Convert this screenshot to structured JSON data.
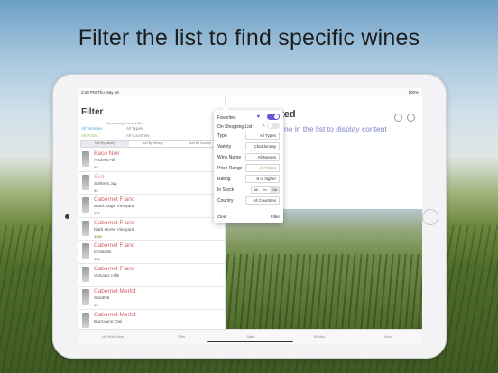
{
  "headline": "Filter the list to find specific wines",
  "status": {
    "time": "2:20 PM",
    "date": "Thu May 16",
    "battery": "100%"
  },
  "master": {
    "title": "Filter",
    "tap_hint": "Tap to change current filter",
    "summary": {
      "varieties": "All Varieties",
      "types": "All Types",
      "prices": "All Prices",
      "countries": "All Countries"
    },
    "sort_buttons": [
      "Sort By Variety",
      "Sort By Winery",
      "Sort By Country"
    ],
    "wines": [
      {
        "name": "Baco Noir",
        "maker": "Ancient Hill",
        "price": "$$"
      },
      {
        "name": "Bird",
        "maker": "Steller's Jay",
        "price": "$$"
      },
      {
        "name": "Cabernet Franc",
        "maker": "Black Sage Vineyard",
        "price": "$$$"
      },
      {
        "name": "Cabernet Franc",
        "maker": "Dark Horse Vineyard",
        "price": "$$$$"
      },
      {
        "name": "Cabernet Franc",
        "maker": "Inniskillin",
        "price": "$$$"
      },
      {
        "name": "Cabernet Franc",
        "maker": "Volcanic Hills",
        "price": ""
      },
      {
        "name": "Cabernet Merlot",
        "maker": "Sandhill",
        "price": "$$"
      },
      {
        "name": "Cabernet Merlot",
        "maker": "Burrowing Owl",
        "price": ""
      }
    ]
  },
  "detail": {
    "title": "cted",
    "hint": "ne in the list to display content"
  },
  "filter_popover": {
    "favorites_label": "Favorites",
    "shopping_label": "On Shopping List",
    "type_label": "Type",
    "type_value": "All Types",
    "variety_label": "Variety",
    "variety_value": "Chardonnay",
    "wine_name_label": "Wine Name",
    "wine_name_value": "All Names",
    "price_label": "Price Range",
    "price_value": "All Prices",
    "rating_label": "Rating",
    "rating_value": "8 or higher",
    "in_stock_label": "In Stock",
    "in_stock_options": [
      "All",
      "In",
      "Out"
    ],
    "country_label": "Country",
    "country_value": "All Countries",
    "clear_label": "Clear",
    "filter_label": "Filter"
  },
  "tabs": [
    "My Wine Cellar",
    "Filter",
    "Stats",
    "Wishlist",
    "More"
  ],
  "colors": {
    "accent": "#6b55d8",
    "wine_name": "#d0606a",
    "price": "#6a9c3c"
  }
}
